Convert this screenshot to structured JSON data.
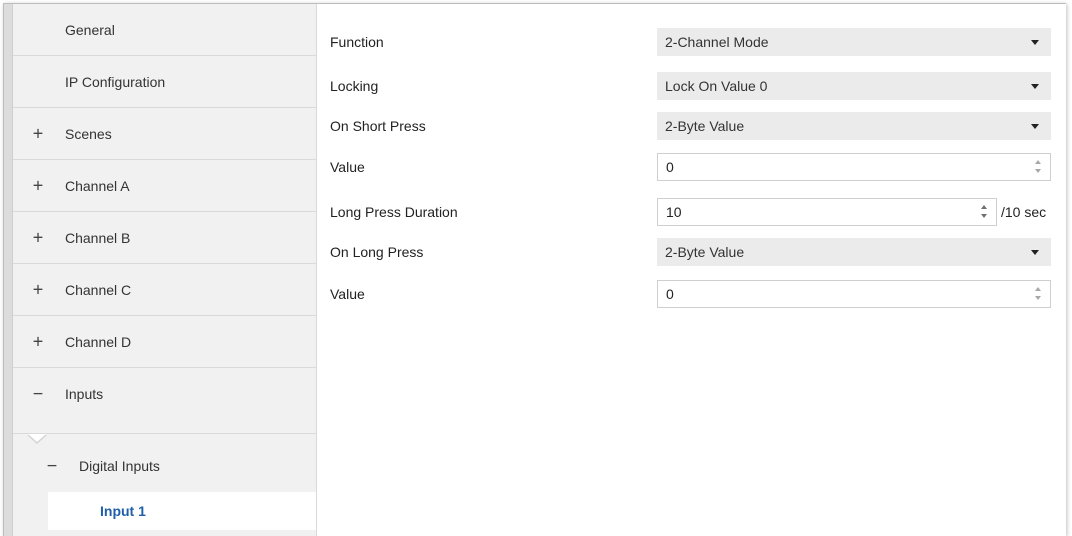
{
  "sidebar": {
    "items": [
      {
        "label": "General",
        "sign": ""
      },
      {
        "label": "IP Configuration",
        "sign": ""
      },
      {
        "label": "Scenes",
        "sign": "+"
      },
      {
        "label": "Channel A",
        "sign": "+"
      },
      {
        "label": "Channel B",
        "sign": "+"
      },
      {
        "label": "Channel C",
        "sign": "+"
      },
      {
        "label": "Channel D",
        "sign": "+"
      },
      {
        "label": "Inputs",
        "sign": "−"
      },
      {
        "label": "Digital Inputs",
        "sign": "−"
      },
      {
        "label": "Input 1",
        "sign": ""
      }
    ]
  },
  "form": {
    "function": {
      "label": "Function",
      "value": "2-Channel Mode"
    },
    "locking": {
      "label": "Locking",
      "value": "Lock On Value 0"
    },
    "on_short_press": {
      "label": "On Short Press",
      "value": "2-Byte Value"
    },
    "value_short": {
      "label": "Value",
      "value": "0"
    },
    "long_press_duration": {
      "label": "Long Press Duration",
      "value": "10",
      "unit": "/10 sec"
    },
    "on_long_press": {
      "label": "On Long Press",
      "value": "2-Byte Value"
    },
    "value_long": {
      "label": "Value",
      "value": "0"
    }
  },
  "colors": {
    "active_item_text": "#1f5ea8",
    "sidebar_bg": "#f1f1f1",
    "select_bg": "#ebebeb"
  }
}
